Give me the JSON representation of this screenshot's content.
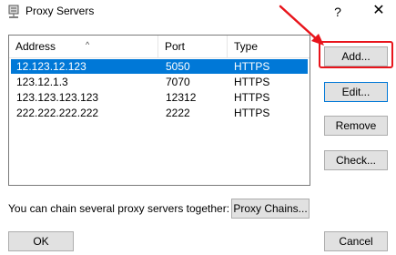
{
  "window": {
    "title": "Proxy Servers",
    "help_glyph": "?",
    "close_glyph": "✕"
  },
  "list": {
    "columns": [
      "Address",
      "Port",
      "Type"
    ],
    "sort_indicator": "^",
    "rows": [
      {
        "address": "12.123.12.123",
        "port": "5050",
        "type": "HTTPS",
        "selected": true
      },
      {
        "address": "123.12.1.3",
        "port": "7070",
        "type": "HTTPS",
        "selected": false
      },
      {
        "address": "123.123.123.123",
        "port": "12312",
        "type": "HTTPS",
        "selected": false
      },
      {
        "address": "222.222.222.222",
        "port": "2222",
        "type": "HTTPS",
        "selected": false
      }
    ]
  },
  "buttons": {
    "add": "Add...",
    "edit": "Edit...",
    "remove": "Remove",
    "check": "Check...",
    "proxy_chains": "Proxy Chains...",
    "ok": "OK",
    "cancel": "Cancel"
  },
  "chain_text": "You can chain several proxy servers together:",
  "colors": {
    "selection": "#0078d7",
    "annotation": "#e8141b",
    "button_face": "#e1e1e1"
  },
  "icons": {
    "title": "proxy-server-icon",
    "annotation": "red-arrow-icon"
  }
}
